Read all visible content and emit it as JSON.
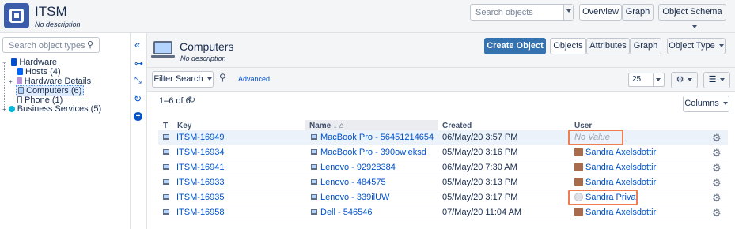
{
  "app": {
    "title": "ITSM",
    "subtitle": "No description"
  },
  "header": {
    "search_placeholder": "Search objects",
    "overview": "Overview",
    "graph": "Graph",
    "object_schema": "Object Schema"
  },
  "left": {
    "search_placeholder": "Search object types",
    "tree": [
      {
        "label": "Hardware",
        "level": 0
      },
      {
        "label": "Hosts (4)",
        "level": 1
      },
      {
        "label": "Hardware Details",
        "level": 1
      },
      {
        "label": "Computers (6)",
        "level": 1,
        "selected": true
      },
      {
        "label": "Phone (1)",
        "level": 1
      },
      {
        "label": "Business Services (5)",
        "level": 0
      }
    ]
  },
  "object_type": {
    "title": "Computers",
    "description": "No description"
  },
  "actions": {
    "create": "Create Object",
    "objects": "Objects",
    "attributes": "Attributes",
    "graph": "Graph",
    "object_type": "Object Type"
  },
  "toolbar": {
    "filter": "Filter Search",
    "advanced": "Advanced",
    "page_size": "25"
  },
  "results": {
    "count": "1–6 of 6",
    "columns_btn": "Columns"
  },
  "table": {
    "headers": {
      "t": "T",
      "key": "Key",
      "name": "Name",
      "created": "Created",
      "user": "User"
    },
    "rows": [
      {
        "key": "ITSM-16949",
        "name": "MacBook Pro - 56451214654",
        "created": "06/May/20 3:57 PM",
        "user": "No Value",
        "user_type": "none"
      },
      {
        "key": "ITSM-16934",
        "name": "MacBook Pro - 390owieksd",
        "created": "05/May/20 3:16 PM",
        "user": "Sandra Axelsdottir",
        "user_type": "photo"
      },
      {
        "key": "ITSM-16941",
        "name": "Lenovo - 92928384",
        "created": "06/May/20 7:30 AM",
        "user": "Sandra Axelsdottir",
        "user_type": "photo"
      },
      {
        "key": "ITSM-16933",
        "name": "Lenovo - 484575",
        "created": "05/May/20 3:13 PM",
        "user": "Sandra Axelsdottir",
        "user_type": "photo"
      },
      {
        "key": "ITSM-16935",
        "name": "Lenovo - 339ilUW",
        "created": "05/May/20 3:17 PM",
        "user": "Sandra Privat",
        "user_type": "default"
      },
      {
        "key": "ITSM-16958",
        "name": "Dell - 546546",
        "created": "07/May/20 11:04 AM",
        "user": "Sandra Axelsdottir",
        "user_type": "photo"
      }
    ]
  },
  "colors": {
    "accent": "#0052cc",
    "primary_button": "#3572b0",
    "highlight": "#ee7d52"
  }
}
